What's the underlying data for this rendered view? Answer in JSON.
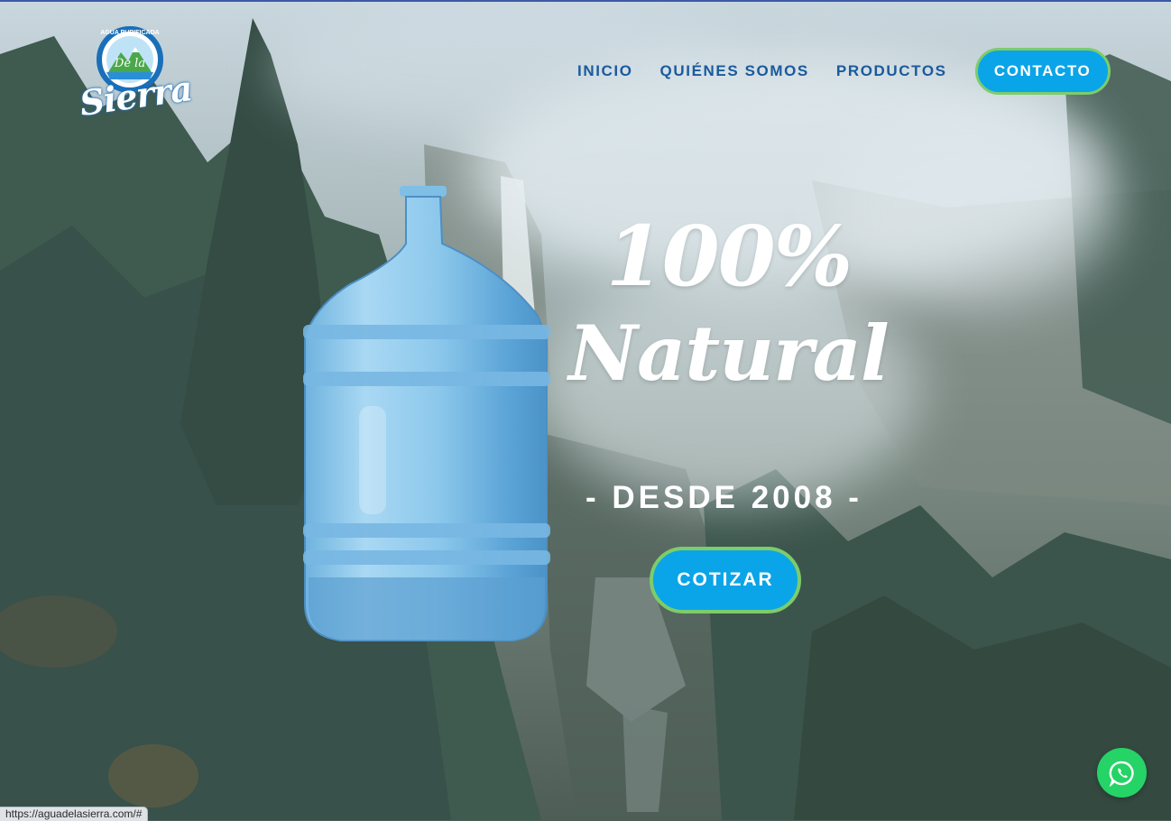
{
  "logo": {
    "arc_text": "AGUA PURIFICADA",
    "script_small": "De la",
    "script_large": "Sierra"
  },
  "nav": {
    "items": [
      "INICIO",
      "QUIÉNES SOMOS",
      "PRODUCTOS"
    ],
    "contact_label": "CONTACTO"
  },
  "hero": {
    "headline_line1": "100%",
    "headline_line2": "Natural",
    "since": "- DESDE 2008 -",
    "cta_label": "COTIZAR"
  },
  "status_bar": {
    "url": "https://aguadelasierra.com/#"
  },
  "colors": {
    "brand_blue": "#1a5a9c",
    "button_blue": "#0aa4e8",
    "button_border_green": "#7dcc6b",
    "whatsapp_green": "#25d366"
  },
  "icons": [
    "logo-mountain-emblem",
    "water-jug-image",
    "whatsapp-icon"
  ]
}
